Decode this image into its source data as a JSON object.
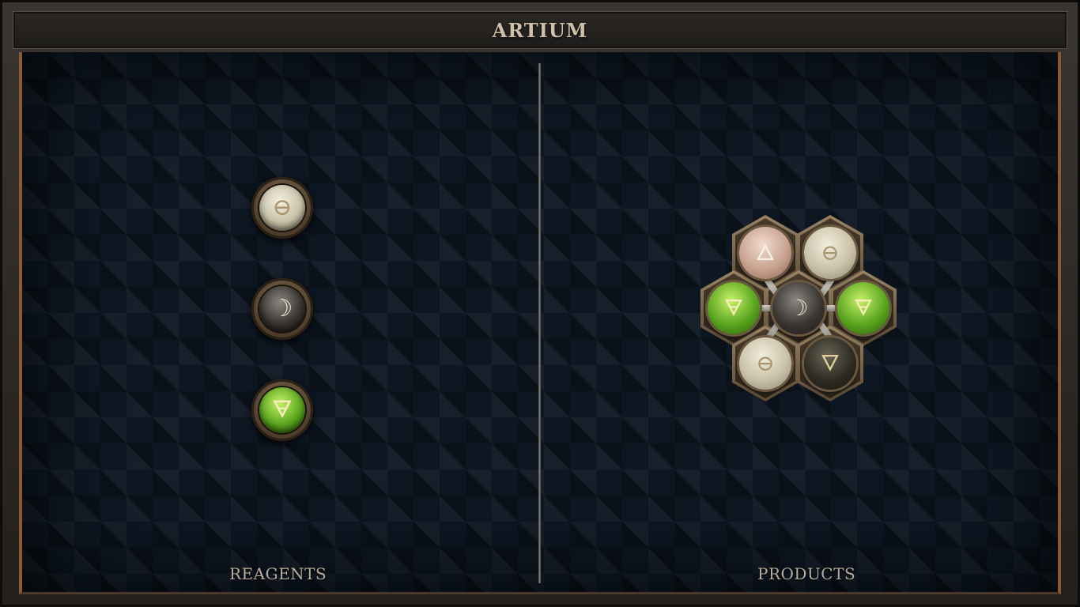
{
  "title": "ARTIUM",
  "sections": {
    "reagents_label": "REAGENTS",
    "products_label": "PRODUCTS"
  },
  "reagents": [
    {
      "element": "salt",
      "glyph": "⊖"
    },
    {
      "element": "quicksilver",
      "glyph": "☽"
    },
    {
      "element": "earth",
      "glyph": "🜃"
    }
  ],
  "product": {
    "center": {
      "element": "quicksilver",
      "glyph": "☽"
    },
    "atoms": [
      {
        "element": "fire",
        "glyph": "🜂"
      },
      {
        "element": "salt",
        "glyph": "⊖"
      },
      {
        "element": "earth",
        "glyph": "🜃"
      },
      {
        "element": "earth",
        "glyph": "🜃"
      },
      {
        "element": "salt",
        "glyph": "⊖"
      },
      {
        "element": "dark",
        "glyph": "🜄"
      }
    ]
  },
  "colors": {
    "board": "#0d1722",
    "frame_trim": "#8a5a34",
    "text": "#cdbfa8",
    "earth": "#5aa51e",
    "salt": "#c9c2a8",
    "fire": "#c9a390"
  }
}
